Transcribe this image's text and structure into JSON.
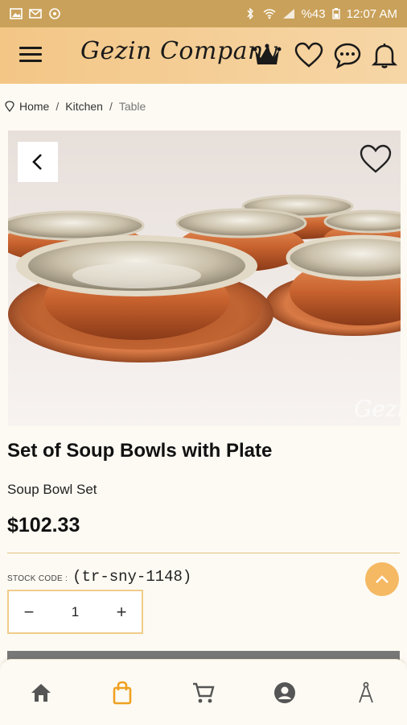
{
  "status": {
    "battery": "%43",
    "time": "12:07 AM"
  },
  "header": {
    "brand": "Gezin Company"
  },
  "breadcrumb": {
    "items": [
      "Home",
      "Kitchen",
      "Table"
    ]
  },
  "product": {
    "title": "Set of Soup Bowls with Plate",
    "subtitle": "Soup Bowl Set",
    "price": "$102.33",
    "stock_label": "STOCK CODE :",
    "stock_code": "(tr-sny-1148)",
    "quantity": "1",
    "watermark": "Gezin"
  },
  "colors": {
    "accent": "#f5b963",
    "header_bg": "#f3c686",
    "status_bg": "#c9a15a",
    "active_nav": "#f0a020"
  },
  "bottom_nav": {
    "items": [
      "home-icon",
      "shopping-bag-icon",
      "cart-icon",
      "account-icon",
      "compass-icon"
    ],
    "active": "shopping-bag-icon"
  }
}
